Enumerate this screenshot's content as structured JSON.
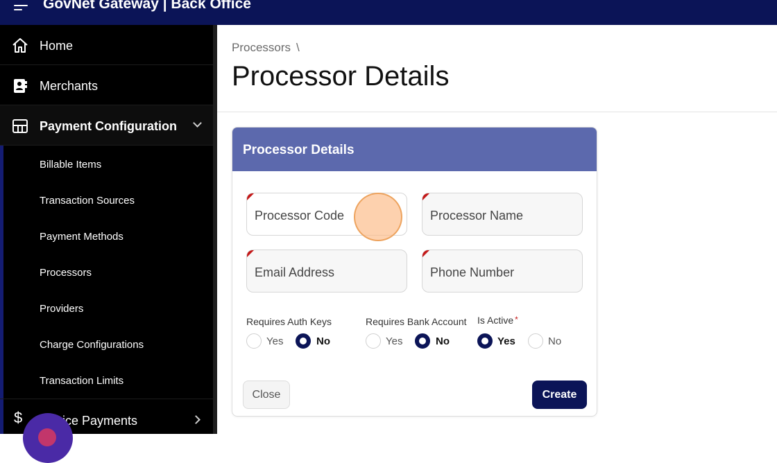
{
  "app": {
    "title": "GovNet Gateway | Back Office"
  },
  "sidebar": {
    "items": [
      {
        "label": "Home",
        "icon": "home-icon"
      },
      {
        "label": "Merchants",
        "icon": "contacts-book-icon"
      },
      {
        "label": "Payment Configuration",
        "icon": "payment-config-icon",
        "expanded": true
      },
      {
        "label": "Invoice Payments",
        "icon": "dollar-icon"
      }
    ],
    "payment_config_children": [
      "Billable Items",
      "Transaction Sources",
      "Payment Methods",
      "Processors",
      "Providers",
      "Charge Configurations",
      "Transaction Limits"
    ],
    "partial_invoice_label": "ice Payments"
  },
  "breadcrumb": {
    "parent": "Processors",
    "separator": "\\"
  },
  "page": {
    "title": "Processor Details"
  },
  "form": {
    "card_title": "Processor Details",
    "fields": {
      "processor_code": {
        "placeholder": "Processor Code",
        "required": true
      },
      "processor_name": {
        "placeholder": "Processor Name",
        "required": true
      },
      "email": {
        "placeholder": "Email Address",
        "required": true
      },
      "phone": {
        "placeholder": "Phone Number",
        "required": true
      }
    },
    "radio_groups": {
      "auth_keys": {
        "label": "Requires Auth Keys",
        "yes": "Yes",
        "no": "No",
        "selected": "No"
      },
      "bank_account": {
        "label": "Requires Bank Account",
        "yes": "Yes",
        "no": "No",
        "selected": "No"
      },
      "is_active": {
        "label": "Is Active",
        "required_mark": "*",
        "yes": "Yes",
        "no": "No",
        "selected": "Yes"
      }
    },
    "buttons": {
      "close": "Close",
      "create": "Create"
    }
  },
  "colors": {
    "topbar": "#0b1457",
    "card_header": "#5c69ad",
    "primary": "#0b1457",
    "required": "#c41818",
    "click_marker": "#fcbe8c"
  }
}
